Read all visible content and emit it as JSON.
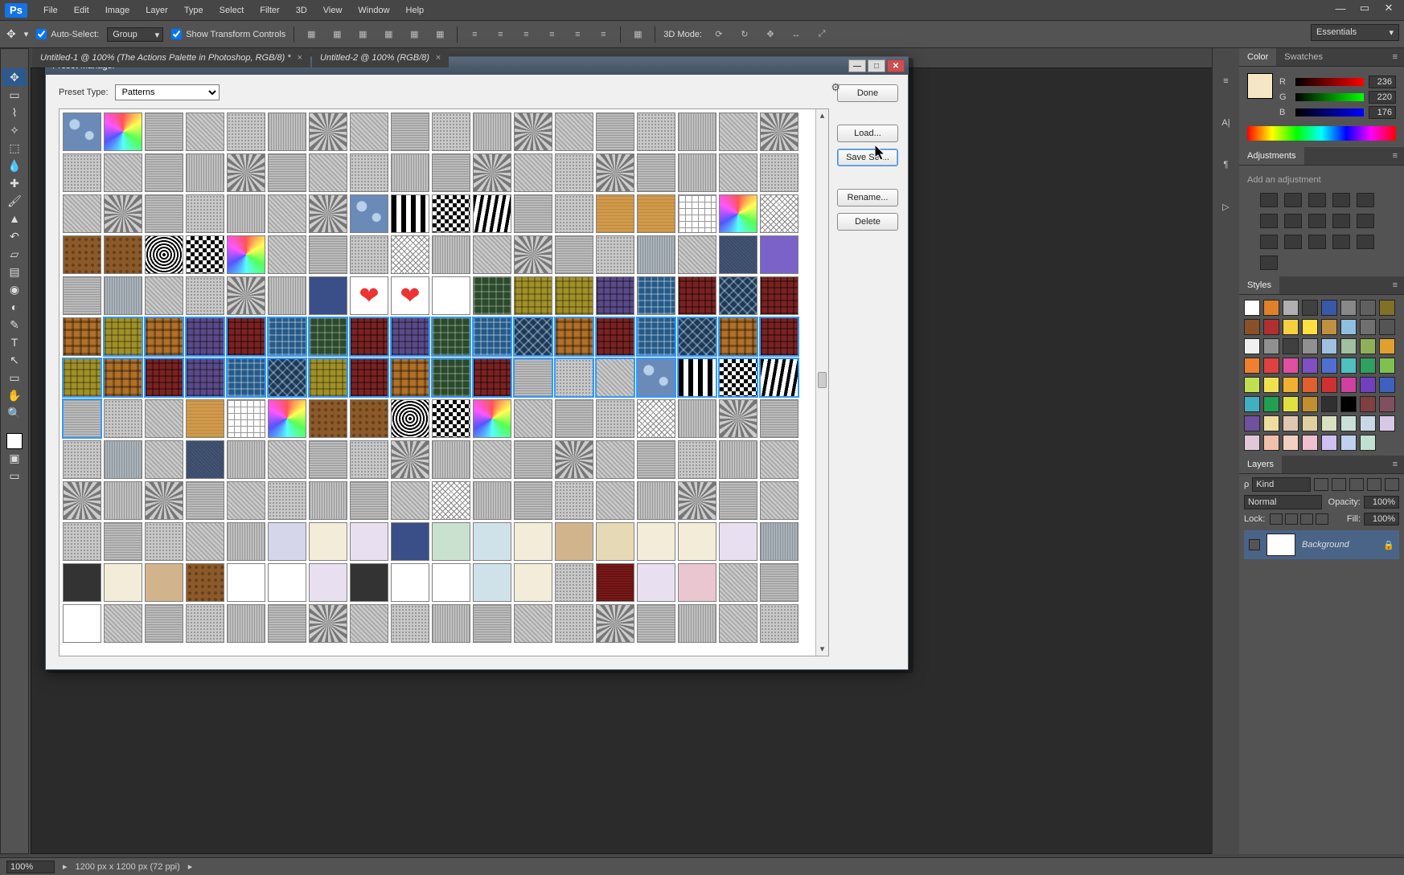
{
  "app": {
    "name": "Ps"
  },
  "menu": [
    "File",
    "Edit",
    "Image",
    "Layer",
    "Type",
    "Select",
    "Filter",
    "3D",
    "View",
    "Window",
    "Help"
  ],
  "options": {
    "autoSelect": "Auto-Select:",
    "autoSelectMode": "Group",
    "showTransform": "Show Transform Controls",
    "threeDModeLabel": "3D Mode:"
  },
  "workspace": "Essentials",
  "tabs": [
    "Untitled-1 @ 100% (The Actions Palette in Photoshop, RGB/8) *",
    "Untitled-2 @ 100% (RGB/8)"
  ],
  "tools": [
    "move",
    "marquee",
    "lasso",
    "wand",
    "crop",
    "eyedropper",
    "heal",
    "brush",
    "stamp",
    "history",
    "eraser",
    "gradient",
    "blur",
    "dodge",
    "pen",
    "type",
    "path",
    "shape",
    "hand",
    "zoom"
  ],
  "dialog": {
    "title": "Preset Manager",
    "presetTypeLabel": "Preset Type:",
    "presetTypeValue": "Patterns",
    "buttons": {
      "done": "Done",
      "load": "Load...",
      "save": "Save Set...",
      "rename": "Rename...",
      "delete": "Delete"
    },
    "gridCount": 234,
    "selectionRange": {
      "startRow": 5,
      "endRow": 6
    }
  },
  "colorPanel": {
    "tab1": "Color",
    "tab2": "Swatches",
    "r": {
      "label": "R",
      "value": "236"
    },
    "g": {
      "label": "G",
      "value": "220"
    },
    "b": {
      "label": "B",
      "value": "176"
    }
  },
  "adjustPanel": {
    "title": "Adjustments",
    "hint": "Add an adjustment"
  },
  "stylesPanel": {
    "title": "Styles",
    "swatches": [
      "#ffffff",
      "#e08028",
      "#b0b0b0",
      "#404040",
      "#3858a8",
      "#888888",
      "#606060",
      "#807028",
      "#8a5028",
      "#b03030",
      "#f6d040",
      "#ffe040",
      "#c09040",
      "#90c0e0",
      "#707070",
      "#555555",
      "#f0f0f0",
      "#909090",
      "#404040",
      "#909090",
      "#a0c0e0",
      "#a0c0a0",
      "#90b058",
      "#e0a030",
      "#f08030",
      "#e04040",
      "#e050a0",
      "#8050c0",
      "#5070d0",
      "#50c0c0",
      "#30a060",
      "#80c050",
      "#c0e050",
      "#f0e050",
      "#f0b030",
      "#e06030",
      "#d03030",
      "#d040a0",
      "#7040c0",
      "#4060c0",
      "#40b0c0",
      "#20a050",
      "#e0e040",
      "#c09030",
      "#303030",
      "#000000",
      "#804040",
      "#805060",
      "#7050a0",
      "#eedda0",
      "#e0c8b0",
      "#e0d0a0",
      "#d8e0c0",
      "#c8e0d8",
      "#c8d8e8",
      "#d8c8e8",
      "#e0c8d8",
      "#f0c0a8",
      "#f0d0c0",
      "#f0c0d0",
      "#d0c0f0",
      "#c0d0f0",
      "#c0e0d0"
    ]
  },
  "layersPanel": {
    "title": "Layers",
    "kind": "Kind",
    "blend": "Normal",
    "opacityLabel": "Opacity:",
    "opacityVal": "100%",
    "lockLabel": "Lock:",
    "fillLabel": "Fill:",
    "fillVal": "100%",
    "layerName": "Background"
  },
  "status": {
    "zoom": "100%",
    "docinfo": "1200 px x 1200 px (72 ppi)"
  }
}
